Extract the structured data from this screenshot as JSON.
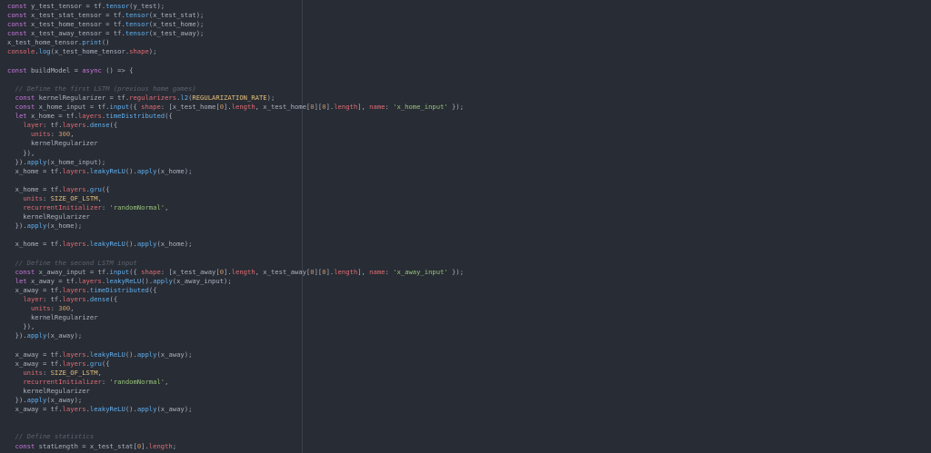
{
  "colors": {
    "background": "#282c34",
    "keyword": "#c678dd",
    "text": "#abb2bf",
    "function": "#61afef",
    "property": "#e06c75",
    "string": "#98c379",
    "number": "#d19a66",
    "comment": "#5c6370",
    "constant": "#e5c07b"
  },
  "code_lines": [
    [
      [
        "kw",
        "const"
      ],
      [
        "var",
        " y_test_tensor = tf."
      ],
      [
        "fn",
        "tensor"
      ],
      [
        "var",
        "(y_test);"
      ]
    ],
    [
      [
        "kw",
        "const"
      ],
      [
        "var",
        " x_test_stat_tensor = tf."
      ],
      [
        "fn",
        "tensor"
      ],
      [
        "var",
        "(x_test_stat);"
      ]
    ],
    [
      [
        "kw",
        "const"
      ],
      [
        "var",
        " x_test_home_tensor = tf."
      ],
      [
        "fn",
        "tensor"
      ],
      [
        "var",
        "(x_test_home);"
      ]
    ],
    [
      [
        "kw",
        "const"
      ],
      [
        "var",
        " x_test_away_tensor = tf."
      ],
      [
        "fn",
        "tensor"
      ],
      [
        "var",
        "(x_test_away);"
      ]
    ],
    [
      [
        "var",
        "x_test_home_tensor."
      ],
      [
        "fn",
        "print"
      ],
      [
        "var",
        "()"
      ]
    ],
    [
      [
        "prop",
        "console"
      ],
      [
        "var",
        "."
      ],
      [
        "fn",
        "log"
      ],
      [
        "var",
        "(x_test_home_tensor."
      ],
      [
        "prop",
        "shape"
      ],
      [
        "var",
        ");"
      ]
    ],
    [],
    [
      [
        "kw",
        "const"
      ],
      [
        "var",
        " buildModel = "
      ],
      [
        "kw",
        "async"
      ],
      [
        "var",
        " () => {"
      ]
    ],
    [],
    [
      [
        "var",
        "  "
      ],
      [
        "com",
        "// Define the first LSTM (previous home games)"
      ]
    ],
    [
      [
        "var",
        "  "
      ],
      [
        "kw",
        "const"
      ],
      [
        "var",
        " kernelRegularizer = tf."
      ],
      [
        "prop",
        "regularizers"
      ],
      [
        "var",
        "."
      ],
      [
        "fn",
        "l2"
      ],
      [
        "var",
        "("
      ],
      [
        "cls",
        "REGULARIZATION_RATE"
      ],
      [
        "var",
        ");"
      ]
    ],
    [
      [
        "var",
        "  "
      ],
      [
        "kw",
        "const"
      ],
      [
        "var",
        " x_home_input = tf."
      ],
      [
        "fn",
        "input"
      ],
      [
        "var",
        "({ "
      ],
      [
        "prop",
        "shape"
      ],
      [
        "var",
        ": [x_test_home["
      ],
      [
        "num",
        "0"
      ],
      [
        "var",
        "]."
      ],
      [
        "prop",
        "length"
      ],
      [
        "var",
        ", x_test_home["
      ],
      [
        "num",
        "0"
      ],
      [
        "var",
        "]["
      ],
      [
        "num",
        "0"
      ],
      [
        "var",
        "]."
      ],
      [
        "prop",
        "length"
      ],
      [
        "var",
        "], "
      ],
      [
        "prop",
        "name"
      ],
      [
        "var",
        ": "
      ],
      [
        "str",
        "'x_home_input'"
      ],
      [
        "var",
        " });"
      ]
    ],
    [
      [
        "var",
        "  "
      ],
      [
        "kw",
        "let"
      ],
      [
        "var",
        " x_home = tf."
      ],
      [
        "prop",
        "layers"
      ],
      [
        "var",
        "."
      ],
      [
        "fn",
        "timeDistributed"
      ],
      [
        "var",
        "({"
      ]
    ],
    [
      [
        "var",
        "    "
      ],
      [
        "prop",
        "layer"
      ],
      [
        "var",
        ": tf."
      ],
      [
        "prop",
        "layers"
      ],
      [
        "var",
        "."
      ],
      [
        "fn",
        "dense"
      ],
      [
        "var",
        "({"
      ]
    ],
    [
      [
        "var",
        "      "
      ],
      [
        "prop",
        "units"
      ],
      [
        "var",
        ": "
      ],
      [
        "num",
        "300"
      ],
      [
        "var",
        ","
      ]
    ],
    [
      [
        "var",
        "      kernelRegularizer"
      ]
    ],
    [
      [
        "var",
        "    }),"
      ]
    ],
    [
      [
        "var",
        "  })."
      ],
      [
        "fn",
        "apply"
      ],
      [
        "var",
        "(x_home_input);"
      ]
    ],
    [
      [
        "var",
        "  x_home = tf."
      ],
      [
        "prop",
        "layers"
      ],
      [
        "var",
        "."
      ],
      [
        "fn",
        "leakyReLU"
      ],
      [
        "var",
        "()."
      ],
      [
        "fn",
        "apply"
      ],
      [
        "var",
        "(x_home);"
      ]
    ],
    [],
    [
      [
        "var",
        "  x_home = tf."
      ],
      [
        "prop",
        "layers"
      ],
      [
        "var",
        "."
      ],
      [
        "fn",
        "gru"
      ],
      [
        "var",
        "({"
      ]
    ],
    [
      [
        "var",
        "    "
      ],
      [
        "prop",
        "units"
      ],
      [
        "var",
        ": "
      ],
      [
        "cls",
        "SIZE_OF_LSTM"
      ],
      [
        "var",
        ","
      ]
    ],
    [
      [
        "var",
        "    "
      ],
      [
        "prop",
        "recurrentInitializer"
      ],
      [
        "var",
        ": "
      ],
      [
        "str",
        "'randomNormal'"
      ],
      [
        "var",
        ","
      ]
    ],
    [
      [
        "var",
        "    kernelRegularizer"
      ]
    ],
    [
      [
        "var",
        "  })."
      ],
      [
        "fn",
        "apply"
      ],
      [
        "var",
        "(x_home);"
      ]
    ],
    [],
    [
      [
        "var",
        "  x_home = tf."
      ],
      [
        "prop",
        "layers"
      ],
      [
        "var",
        "."
      ],
      [
        "fn",
        "leakyReLU"
      ],
      [
        "var",
        "()."
      ],
      [
        "fn",
        "apply"
      ],
      [
        "var",
        "(x_home);"
      ]
    ],
    [],
    [
      [
        "var",
        "  "
      ],
      [
        "com",
        "// Define the second LSTM input"
      ]
    ],
    [
      [
        "var",
        "  "
      ],
      [
        "kw",
        "const"
      ],
      [
        "var",
        " x_away_input = tf."
      ],
      [
        "fn",
        "input"
      ],
      [
        "var",
        "({ "
      ],
      [
        "prop",
        "shape"
      ],
      [
        "var",
        ": [x_test_away["
      ],
      [
        "num",
        "0"
      ],
      [
        "var",
        "]."
      ],
      [
        "prop",
        "length"
      ],
      [
        "var",
        ", x_test_away["
      ],
      [
        "num",
        "0"
      ],
      [
        "var",
        "]["
      ],
      [
        "num",
        "0"
      ],
      [
        "var",
        "]."
      ],
      [
        "prop",
        "length"
      ],
      [
        "var",
        "], "
      ],
      [
        "prop",
        "name"
      ],
      [
        "var",
        ": "
      ],
      [
        "str",
        "'x_away_input'"
      ],
      [
        "var",
        " });"
      ]
    ],
    [
      [
        "var",
        "  "
      ],
      [
        "kw",
        "let"
      ],
      [
        "var",
        " x_away = tf."
      ],
      [
        "prop",
        "layers"
      ],
      [
        "var",
        "."
      ],
      [
        "fn",
        "leakyReLU"
      ],
      [
        "var",
        "()."
      ],
      [
        "fn",
        "apply"
      ],
      [
        "var",
        "(x_away_input);"
      ]
    ],
    [
      [
        "var",
        "  x_away = tf."
      ],
      [
        "prop",
        "layers"
      ],
      [
        "var",
        "."
      ],
      [
        "fn",
        "timeDistributed"
      ],
      [
        "var",
        "({"
      ]
    ],
    [
      [
        "var",
        "    "
      ],
      [
        "prop",
        "layer"
      ],
      [
        "var",
        ": tf."
      ],
      [
        "prop",
        "layers"
      ],
      [
        "var",
        "."
      ],
      [
        "fn",
        "dense"
      ],
      [
        "var",
        "({"
      ]
    ],
    [
      [
        "var",
        "      "
      ],
      [
        "prop",
        "units"
      ],
      [
        "var",
        ": "
      ],
      [
        "num",
        "300"
      ],
      [
        "var",
        ","
      ]
    ],
    [
      [
        "var",
        "      kernelRegularizer"
      ]
    ],
    [
      [
        "var",
        "    }),"
      ]
    ],
    [
      [
        "var",
        "  })."
      ],
      [
        "fn",
        "apply"
      ],
      [
        "var",
        "(x_away);"
      ]
    ],
    [],
    [
      [
        "var",
        "  x_away = tf."
      ],
      [
        "prop",
        "layers"
      ],
      [
        "var",
        "."
      ],
      [
        "fn",
        "leakyReLU"
      ],
      [
        "var",
        "()."
      ],
      [
        "fn",
        "apply"
      ],
      [
        "var",
        "(x_away);"
      ]
    ],
    [
      [
        "var",
        "  x_away = tf."
      ],
      [
        "prop",
        "layers"
      ],
      [
        "var",
        "."
      ],
      [
        "fn",
        "gru"
      ],
      [
        "var",
        "({"
      ]
    ],
    [
      [
        "var",
        "    "
      ],
      [
        "prop",
        "units"
      ],
      [
        "var",
        ": "
      ],
      [
        "cls",
        "SIZE_OF_LSTM"
      ],
      [
        "var",
        ","
      ]
    ],
    [
      [
        "var",
        "    "
      ],
      [
        "prop",
        "recurrentInitializer"
      ],
      [
        "var",
        ": "
      ],
      [
        "str",
        "'randomNormal'"
      ],
      [
        "var",
        ","
      ]
    ],
    [
      [
        "var",
        "    kernelRegularizer"
      ]
    ],
    [
      [
        "var",
        "  })."
      ],
      [
        "fn",
        "apply"
      ],
      [
        "var",
        "(x_away);"
      ]
    ],
    [
      [
        "var",
        "  x_away = tf."
      ],
      [
        "prop",
        "layers"
      ],
      [
        "var",
        "."
      ],
      [
        "fn",
        "leakyReLU"
      ],
      [
        "var",
        "()."
      ],
      [
        "fn",
        "apply"
      ],
      [
        "var",
        "(x_away);"
      ]
    ],
    [],
    [],
    [
      [
        "var",
        "  "
      ],
      [
        "com",
        "// Define statistics"
      ]
    ],
    [
      [
        "var",
        "  "
      ],
      [
        "kw",
        "const"
      ],
      [
        "var",
        " statLength = x_test_stat["
      ],
      [
        "num",
        "0"
      ],
      [
        "var",
        "]."
      ],
      [
        "prop",
        "length"
      ],
      [
        "var",
        ";"
      ]
    ]
  ]
}
